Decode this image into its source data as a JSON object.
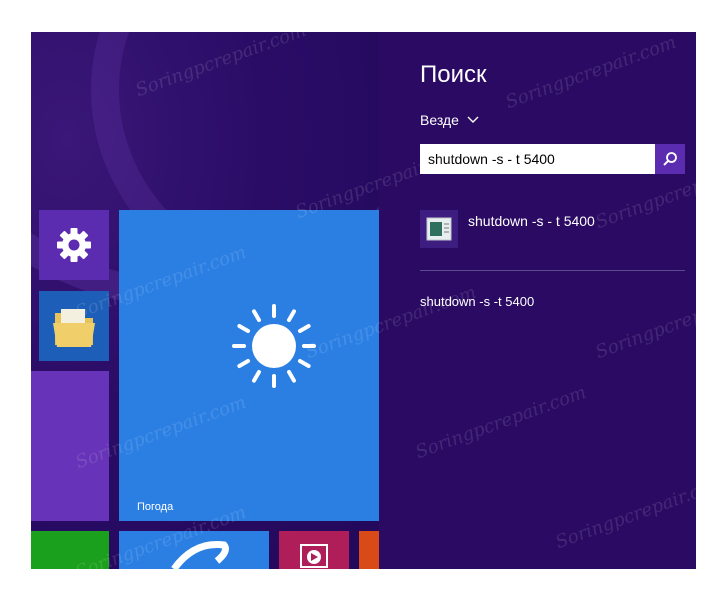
{
  "search_panel": {
    "title": "Поиск",
    "scope_label": "Везде",
    "query_value": "shutdown -s - t 5400",
    "results": {
      "app_result_label": "shutdown -s - t 5400",
      "text_result_label": "shutdown -s -t 5400"
    }
  },
  "start_screen": {
    "weather_tile_label": "Погода"
  },
  "watermark_text": "Soringpcrepair.com",
  "colors": {
    "panel_background": "#2a0a63",
    "accent_purple": "#5b2bb0",
    "weather_tile": "#2b7fe3",
    "settings_tile": "#5b2bb0",
    "explorer_tile": "#1d5fb8",
    "store_tile": "#1aa01d",
    "video_tile": "#b01e5a"
  },
  "icons": {
    "settings": "gear-icon",
    "explorer": "folder-icon",
    "weather": "sun-icon",
    "search": "search-icon",
    "dropdown": "chevron-down-icon",
    "app": "command-prompt-icon",
    "video": "play-icon"
  }
}
